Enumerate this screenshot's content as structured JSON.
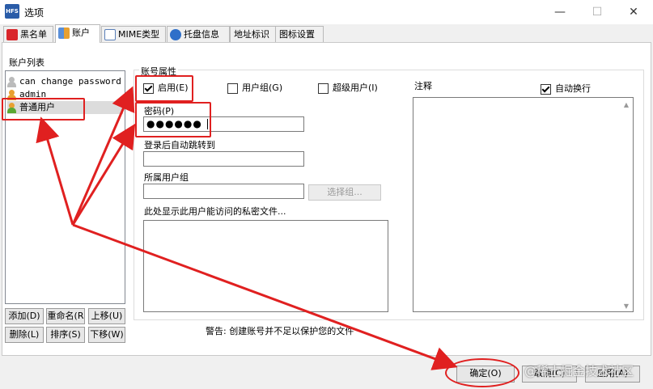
{
  "window": {
    "title": "选项",
    "app_icon_text": "HFS",
    "minimize": "—",
    "maximize": "☐",
    "close": "✕"
  },
  "tabs": [
    {
      "label": "黑名单",
      "icon": "stop-icon"
    },
    {
      "label": "账户",
      "icon": "users-icon"
    },
    {
      "label": "MIME类型",
      "icon": "mime-icon"
    },
    {
      "label": "托盘信息",
      "icon": "info-icon"
    },
    {
      "label": "地址标识",
      "icon": ""
    },
    {
      "label": "图标设置",
      "icon": ""
    }
  ],
  "accounts": {
    "list_label": "账户列表",
    "items": [
      "can change password",
      "admin",
      "普通用户"
    ],
    "buttons": {
      "add": "添加(D)",
      "rename": "重命名(R",
      "move_up": "上移(U)",
      "delete": "删除(L)",
      "sort": "排序(S)",
      "move_down": "下移(W)"
    }
  },
  "properties": {
    "title": "账号属性",
    "enabled_label": "启用(E)",
    "enabled_checked": true,
    "group_label": "用户组(G)",
    "group_checked": false,
    "superuser_label": "超级用户(I)",
    "superuser_checked": false,
    "password_label": "密码(P)",
    "password_value": "●●●●●●",
    "redirect_label": "登录后自动跳转到",
    "redirect_value": "",
    "member_of_label": "所属用户组",
    "member_of_value": "",
    "choose_group_button": "选择组...",
    "private_files_label": "此处显示此用户能访问的私密文件...",
    "notes_label": "注释",
    "word_wrap_label": "自动换行",
    "word_wrap_checked": true
  },
  "warning": "警告: 创建账号并不足以保护您的文件",
  "footer": {
    "ok": "确定(O)",
    "cancel": "取消(C)",
    "apply": "应用(A)"
  },
  "watermark": "@稀土掘金技术社区",
  "colors": {
    "annotation_red": "#e02020",
    "selection": "#dcdcdc",
    "stop_red": "#d9262b",
    "user_green": "#5aa832",
    "user_orange": "#e8a030"
  }
}
